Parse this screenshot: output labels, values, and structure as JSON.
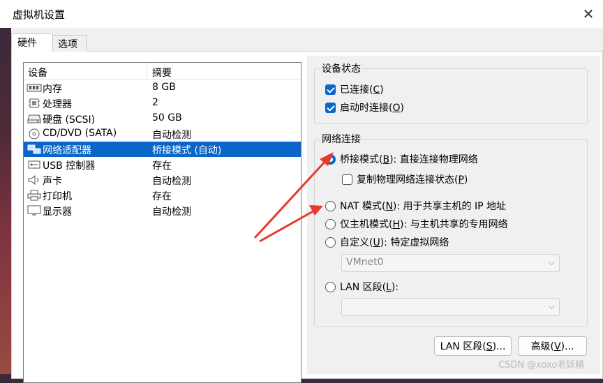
{
  "window": {
    "title": "虚拟机设置"
  },
  "tabs": [
    {
      "label": "硬件"
    },
    {
      "label": "选项"
    }
  ],
  "device_list": {
    "columns": [
      "设备",
      "摘要"
    ],
    "rows": [
      {
        "name": "内存",
        "summary": "8 GB",
        "icon": "memory-icon"
      },
      {
        "name": "处理器",
        "summary": "2",
        "icon": "processor-icon"
      },
      {
        "name": "硬盘 (SCSI)",
        "summary": "50 GB",
        "icon": "hard-disk-icon"
      },
      {
        "name": "CD/DVD (SATA)",
        "summary": "自动检测",
        "icon": "cd-dvd-icon"
      },
      {
        "name": "网络适配器",
        "summary": "桥接模式 (自动)",
        "icon": "network-adapter-icon",
        "selected": true
      },
      {
        "name": "USB 控制器",
        "summary": "存在",
        "icon": "usb-icon"
      },
      {
        "name": "声卡",
        "summary": "自动检测",
        "icon": "sound-card-icon"
      },
      {
        "name": "打印机",
        "summary": "存在",
        "icon": "printer-icon"
      },
      {
        "name": "显示器",
        "summary": "自动检测",
        "icon": "display-icon"
      }
    ]
  },
  "device_status": {
    "title": "设备状态",
    "connected": {
      "label_pre": "已连接(",
      "key": "C",
      "label_post": ")",
      "checked": true
    },
    "connect_on_start": {
      "label_pre": "启动时连接(",
      "key": "O",
      "label_post": ")",
      "checked": true
    }
  },
  "network": {
    "title": "网络连接",
    "bridged": {
      "pre": "桥接模式(",
      "key": "B",
      "post": "): 直接连接物理网络",
      "selected": true
    },
    "replicate": {
      "pre": "复制物理网络连接状态(",
      "key": "P",
      "post": ")",
      "checked": false
    },
    "nat": {
      "pre": "NAT 模式(",
      "key": "N",
      "post": "): 用于共享主机的 IP 地址",
      "selected": false
    },
    "host_only": {
      "pre": "仅主机模式(",
      "key": "H",
      "post": "): 与主机共享的专用网络",
      "selected": false
    },
    "custom": {
      "pre": "自定义(",
      "key": "U",
      "post": "): 特定虚拟网络",
      "selected": false
    },
    "custom_select": "VMnet0",
    "lan": {
      "pre": "LAN 区段(",
      "key": "L",
      "post": "):",
      "selected": false
    },
    "lan_select": ""
  },
  "buttons": {
    "lan_segments": {
      "pre": "LAN 区段(",
      "key": "S",
      "post": ")..."
    },
    "advanced": {
      "pre": "高级(",
      "key": "V",
      "post": ")..."
    }
  },
  "watermark": "CSDN @xoxo老妖精",
  "colors": {
    "selection": "#0a66c8",
    "arrow": "#e83a2a"
  }
}
